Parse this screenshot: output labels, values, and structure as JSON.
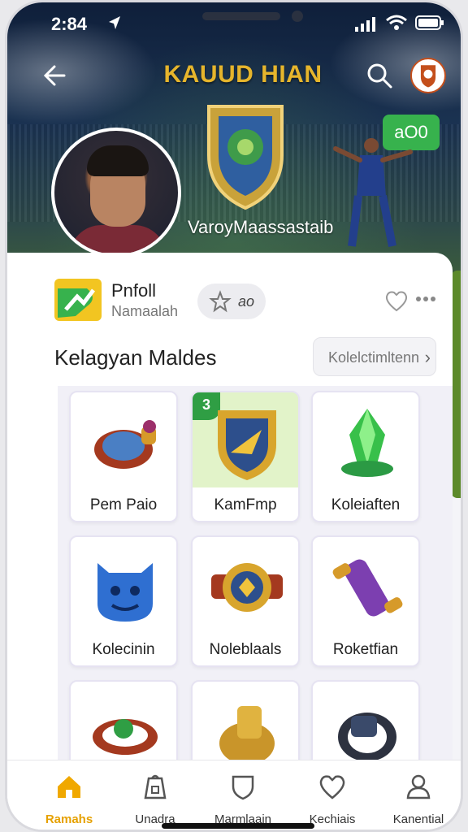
{
  "status": {
    "time": "2:84"
  },
  "header": {
    "title": "KAUUD HIAN",
    "action_label": "aO0"
  },
  "hero": {
    "username": "VaroyMaassastaib"
  },
  "profile": {
    "name": "Pnfoll",
    "subtitle": "Namaalah",
    "rating": "ao"
  },
  "section": {
    "title": "Kelagyan Maldes",
    "collection_button": "Kolelctimltenn"
  },
  "items": [
    {
      "label": "Pem Paio",
      "icon": "magic-lamp-icon"
    },
    {
      "label": "KamFmp",
      "icon": "shield-emblem-icon",
      "badge": "3",
      "selected": true
    },
    {
      "label": "Koleiaften",
      "icon": "green-gem-icon"
    },
    {
      "label": "Kolecinin",
      "icon": "blue-creature-icon"
    },
    {
      "label": "Noleblaals",
      "icon": "gold-medallion-icon"
    },
    {
      "label": "Roketfian",
      "icon": "purple-scroll-icon"
    },
    {
      "label": "",
      "icon": "emerald-bracelet-icon"
    },
    {
      "label": "",
      "icon": "gold-ring-icon"
    },
    {
      "label": "",
      "icon": "smartwatch-icon"
    }
  ],
  "nav": [
    {
      "label": "Ramahs",
      "icon": "home-icon",
      "active": true
    },
    {
      "label": "Unadra",
      "icon": "lantern-icon"
    },
    {
      "label": "Marmlaain",
      "icon": "shield-icon"
    },
    {
      "label": "Kechiais",
      "icon": "heart-icon"
    },
    {
      "label": "Kanential",
      "icon": "user-icon"
    }
  ],
  "colors": {
    "accent": "#e6a100",
    "brand_title": "#e6b52c",
    "action_green": "#37b24d",
    "selected_tile": "#e2f3c9"
  }
}
